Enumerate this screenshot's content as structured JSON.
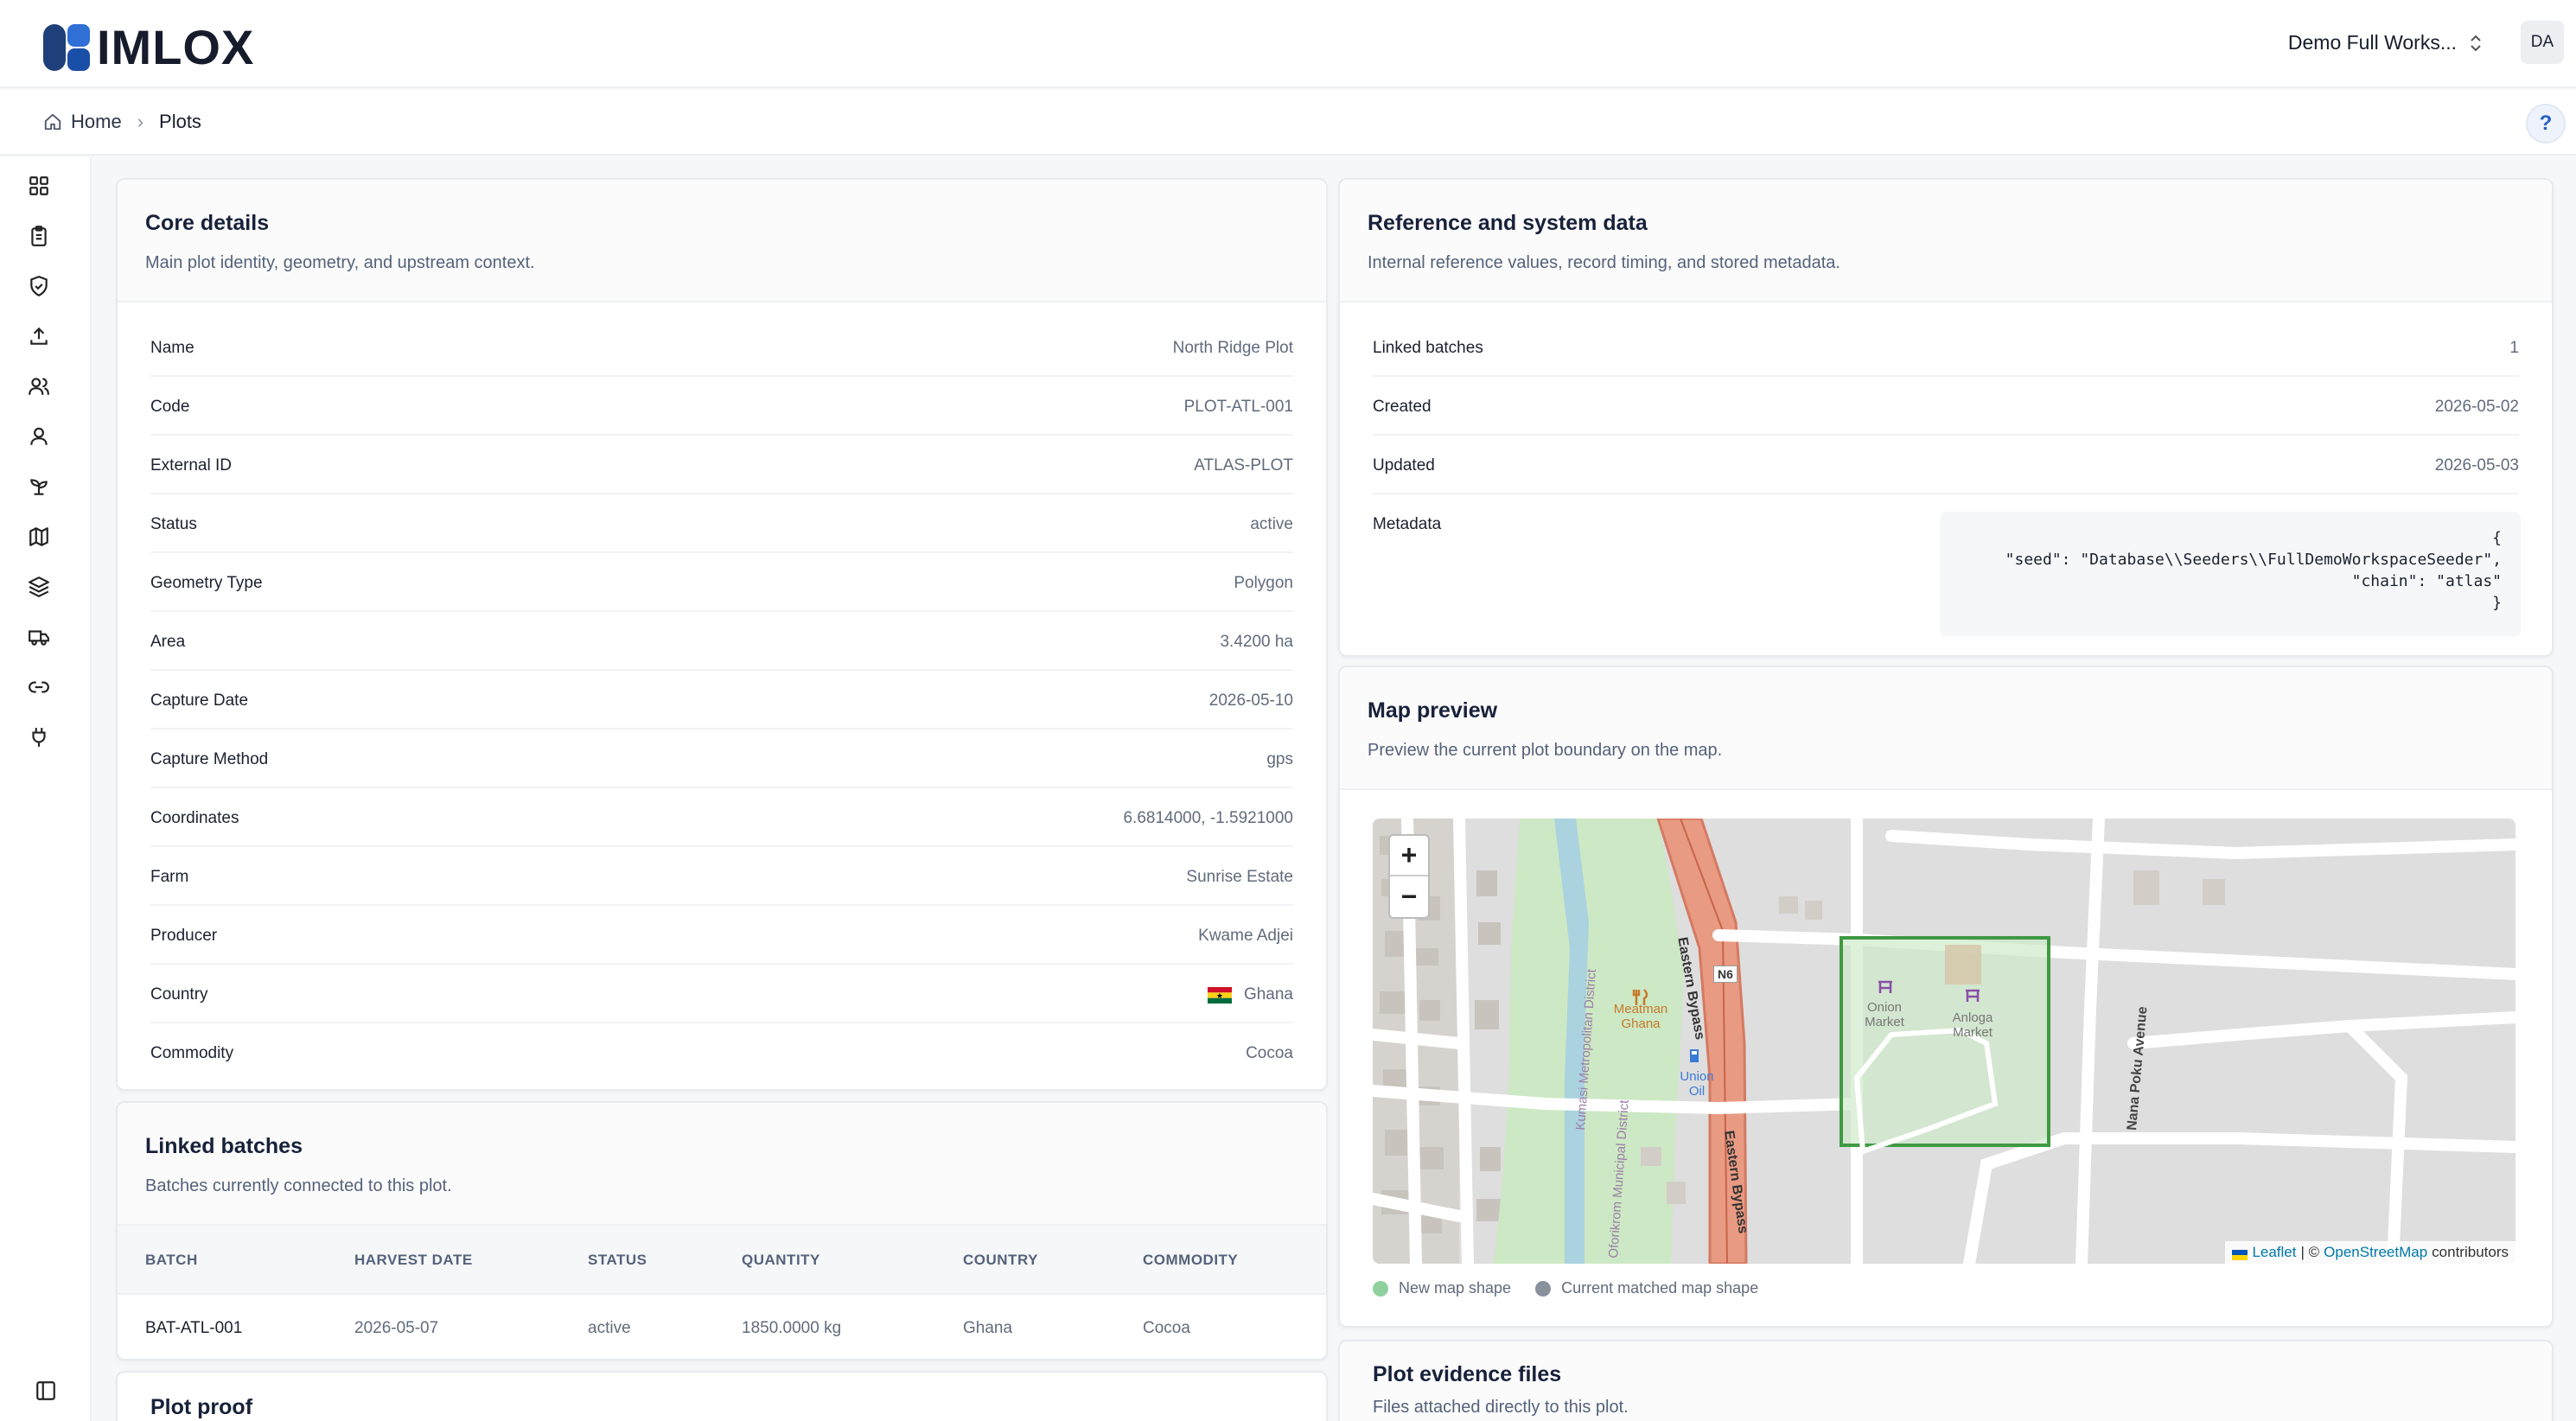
{
  "header": {
    "logo_text": "IMLOX",
    "workspace": "Demo Full Works...",
    "avatar_initials": "DA"
  },
  "breadcrumb": {
    "home": "Home",
    "current": "Plots",
    "help": "?"
  },
  "sidebar": {
    "icons": [
      "dashboard-icon",
      "clipboard-icon",
      "shield-check-icon",
      "upload-icon",
      "users-icon",
      "user-icon",
      "sprout-icon",
      "map-icon",
      "layers-icon",
      "truck-icon",
      "link-icon",
      "plug-icon"
    ],
    "collapse_icon": "sidebar-toggle-icon"
  },
  "core_details": {
    "title": "Core details",
    "subtitle": "Main plot identity, geometry, and upstream context.",
    "rows": [
      {
        "label": "Name",
        "value": "North Ridge Plot"
      },
      {
        "label": "Code",
        "value": "PLOT-ATL-001"
      },
      {
        "label": "External ID",
        "value": "ATLAS-PLOT"
      },
      {
        "label": "Status",
        "value": "active"
      },
      {
        "label": "Geometry Type",
        "value": "Polygon"
      },
      {
        "label": "Area",
        "value": "3.4200 ha"
      },
      {
        "label": "Capture Date",
        "value": "2026-05-10"
      },
      {
        "label": "Capture Method",
        "value": "gps"
      },
      {
        "label": "Coordinates",
        "value": "6.6814000, -1.5921000"
      },
      {
        "label": "Farm",
        "value": "Sunrise Estate"
      },
      {
        "label": "Producer",
        "value": "Kwame Adjei"
      },
      {
        "label": "Country",
        "value": "Ghana"
      },
      {
        "label": "Commodity",
        "value": "Cocoa"
      }
    ]
  },
  "reference": {
    "title": "Reference and system data",
    "subtitle": "Internal reference values, record timing, and stored metadata.",
    "rows": [
      {
        "label": "Linked batches",
        "value": "1"
      },
      {
        "label": "Created",
        "value": "2026-05-02"
      },
      {
        "label": "Updated",
        "value": "2026-05-03"
      },
      {
        "label": "Metadata",
        "value": ""
      }
    ],
    "metadata": "{\n\"seed\": \"Database\\\\Seeders\\\\FullDemoWorkspaceSeeder\",\n\"chain\": \"atlas\"\n}"
  },
  "linked_batches": {
    "title": "Linked batches",
    "subtitle": "Batches currently connected to this plot.",
    "columns": [
      "BATCH",
      "HARVEST DATE",
      "STATUS",
      "QUANTITY",
      "COUNTRY",
      "COMMODITY"
    ],
    "rows": [
      [
        "BAT-ATL-001",
        "2026-05-07",
        "active",
        "1850.0000 kg",
        "Ghana",
        "Cocoa"
      ]
    ]
  },
  "map_preview": {
    "title": "Map preview",
    "subtitle": "Preview the current plot boundary on the map.",
    "zoom_in": "+",
    "zoom_out": "−",
    "labels": {
      "eastern_bypass_1": "Eastern Bypass",
      "eastern_bypass_2": "Eastern Bypass",
      "n6": "N6",
      "nana_poku": "Nana Poku Avenue",
      "oforikrom": "Oforikrom Municipal District",
      "kumasi": "Kumasi Metropolitan District",
      "meatman": "Meatman Ghana",
      "union_oil": "Union Oil",
      "onion_market": "Onion Market",
      "anloga_market": "Anloga Market"
    },
    "attribution": {
      "leaflet": "Leaflet",
      "separator": "| ©",
      "osm": "OpenStreetMap",
      "suffix": "contributors"
    },
    "legend": [
      {
        "label": "New map shape",
        "color": "#8fd19e"
      },
      {
        "label": "Current matched map shape",
        "color": "#8a919e"
      }
    ]
  },
  "plot_proof": {
    "title": "Plot proof"
  },
  "evidence": {
    "title": "Plot evidence files",
    "subtitle": "Files attached directly to this plot."
  }
}
